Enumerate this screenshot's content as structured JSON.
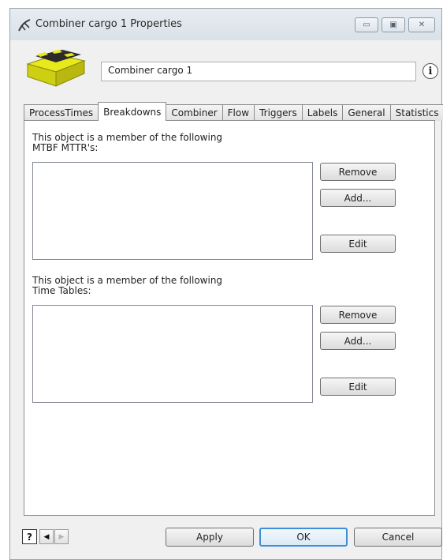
{
  "window": {
    "title": "Combiner cargo 1  Properties",
    "controls": {
      "minimize": "▭",
      "maximize": "▣",
      "close": "✕"
    }
  },
  "object": {
    "name": "Combiner cargo 1",
    "info_icon": "i"
  },
  "tabs": [
    {
      "label": "ProcessTimes",
      "active": false
    },
    {
      "label": "Breakdowns",
      "active": true
    },
    {
      "label": "Combiner",
      "active": false
    },
    {
      "label": "Flow",
      "active": false
    },
    {
      "label": "Triggers",
      "active": false
    },
    {
      "label": "Labels",
      "active": false
    },
    {
      "label": "General",
      "active": false
    },
    {
      "label": "Statistics",
      "active": false
    }
  ],
  "mtbf": {
    "label_line1": "This object is a member of the following",
    "label_line2": "MTBF MTTR's:",
    "remove_label": "Remove",
    "add_label": "Add...",
    "edit_label": "Edit"
  },
  "timetables": {
    "label_line1": "This object is a member of the following",
    "label_line2": "Time Tables:",
    "remove_label": "Remove",
    "add_label": "Add...",
    "edit_label": "Edit"
  },
  "footer": {
    "help_label": "?",
    "prev_label": "◀",
    "next_label": "▶",
    "apply_label": "Apply",
    "ok_label": "OK",
    "cancel_label": "Cancel"
  },
  "colors": {
    "preview_yellow": "#e8e81a",
    "preview_dark": "#2b2b2b",
    "default_button_border": "#3c8fd8"
  }
}
